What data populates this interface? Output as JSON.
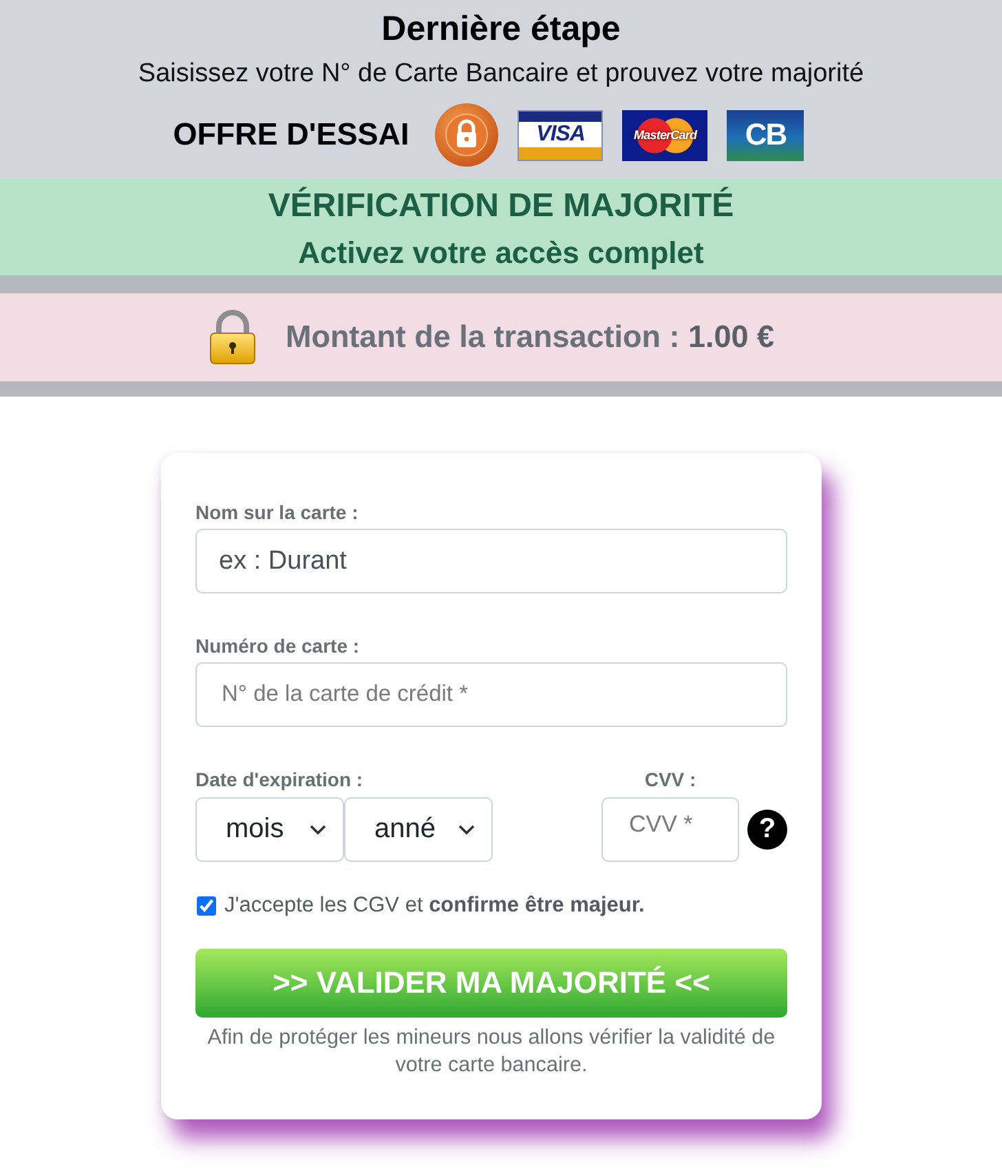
{
  "header": {
    "title": "Dernière étape",
    "subtitle": "Saisissez votre N° de Carte Bancaire et prouvez votre majorité",
    "offer_label": "OFFRE D'ESSAI",
    "card_logos": [
      {
        "kind": "visa",
        "text": "VISA"
      },
      {
        "kind": "mastercard",
        "text": "MasterCard"
      },
      {
        "kind": "cb",
        "text": "CB"
      }
    ]
  },
  "verification_banner": {
    "title": "VÉRIFICATION DE MAJORITÉ",
    "subtitle": "Activez votre accès complet"
  },
  "amount_banner": {
    "text": "Montant de la transaction : **1.00 €**"
  },
  "form": {
    "name_field": {
      "label": "Nom sur la carte :",
      "value": "ex : Durant"
    },
    "number_field": {
      "label": "Numéro de carte :",
      "placeholder": "N° de la carte de crédit *"
    },
    "expiry": {
      "label": "Date d'expiration :",
      "selects": [
        {
          "value": "mois"
        },
        {
          "value": "anné"
        }
      ]
    },
    "cvv": {
      "label": "CVV :",
      "placeholder": "CVV *",
      "help": "?"
    },
    "agreement": {
      "checked": true,
      "text": "J'accepte les CGV et **confirme être majeur.**"
    },
    "submit": ">> VALIDER MA MAJORITÉ <<",
    "note": "Afin de protéger les mineurs nous allons vérifier la validité de votre carte bancaire."
  }
}
